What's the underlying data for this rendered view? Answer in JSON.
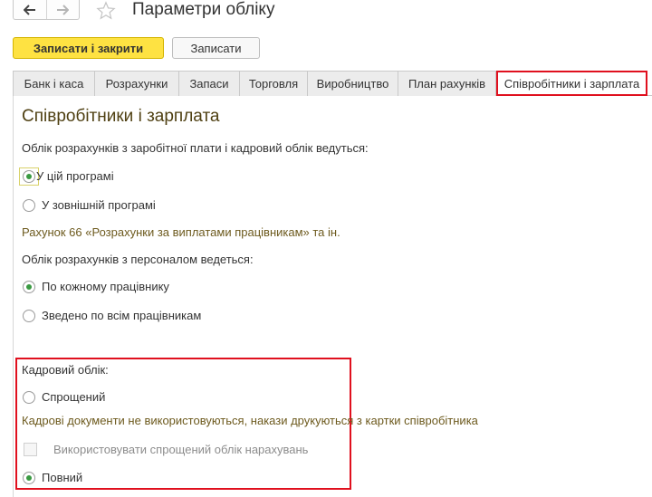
{
  "window": {
    "title": "Параметри обліку",
    "back_icon": "arrow-left-icon",
    "forward_icon": "arrow-right-icon",
    "favorite_icon": "star-icon"
  },
  "toolbar": {
    "save_close_label": "Записати і закрити",
    "save_label": "Записати"
  },
  "tabs": [
    {
      "label": "Банк і каса"
    },
    {
      "label": "Розрахунки"
    },
    {
      "label": "Запаси"
    },
    {
      "label": "Торговля"
    },
    {
      "label": "Виробництво"
    },
    {
      "label": "План рахунків"
    },
    {
      "label": "Співробітники і зарплата",
      "active": true
    }
  ],
  "section": {
    "title": "Співробітники і зарплата",
    "payroll_accounting_label": "Облік розрахунків з заробітної плати і кадровий облік ведуться:",
    "payroll_options": [
      {
        "label": "У цій програмі",
        "checked": true
      },
      {
        "label": "У зовнішній програмі",
        "checked": false
      }
    ],
    "account_note": "Рахунок 66 «Розрахунки за виплатами працівникам» та ін.",
    "personnel_settlement_label": "Облік розрахунків з персоналом ведеться:",
    "personnel_options": [
      {
        "label": "По кожному працівнику",
        "checked": true
      },
      {
        "label": "Зведено по всім працівникам",
        "checked": false
      }
    ],
    "hr_label": "Кадровий облік:",
    "hr_simplified": {
      "label": "Спрощений",
      "checked": false
    },
    "hr_note": "Кадрові документи не використовуються, накази друкуються з картки співробітника",
    "simplified_accruals": {
      "label": "Використовувати спрощений облік нарахувань",
      "checked": false,
      "disabled": true
    },
    "hr_full": {
      "label": "Повний",
      "checked": true
    }
  },
  "colors": {
    "accent_yellow": "#fee242",
    "highlight_red": "#e0101e",
    "radio_green": "#3a9a42",
    "note_brown": "#6d5a1e"
  }
}
